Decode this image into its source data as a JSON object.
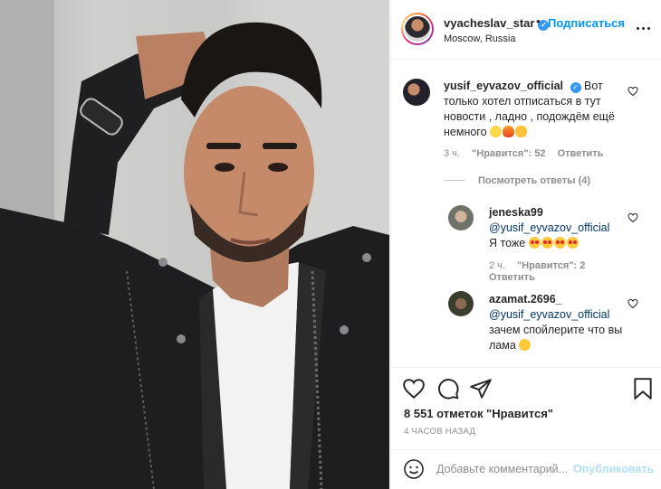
{
  "post": {
    "owner": "vyacheslav_star",
    "dot": "•",
    "follow_label": "Подписаться",
    "location": "Moscow, Russia"
  },
  "comments": [
    {
      "username": "yusif_eyvazov_official",
      "text": "Вот только хотел отписаться в тут новости , ладно , подождём ещё немного",
      "time": "3 ч.",
      "likes": "\"Нравится\": 52",
      "reply": "Ответить",
      "view_replies": "Посмотреть ответы (4)"
    },
    {
      "username": "jeneska99",
      "mention": "@yusif_eyvazov_official",
      "text": "Я тоже",
      "time": "2 ч.",
      "likes": "\"Нравится\": 2",
      "reply": "Ответить"
    },
    {
      "username": "azamat.2696_",
      "mention": "@yusif_eyvazov_official",
      "text": "зачем спойлерите что вы лама"
    }
  ],
  "actions": {
    "likes_count": "8 551 отметок \"Нравится\"",
    "timestamp": "4 ЧАСОВ НАЗАД"
  },
  "comment_box": {
    "placeholder": "Добавьте комментарий...",
    "publish_label": "Опубликовать"
  },
  "colors": {
    "accent": "#0095f6",
    "verified": "#3897f0",
    "publish_disabled": "#b2dffc",
    "muted": "#8e8e8e"
  },
  "icons": [
    "verified-badge-icon",
    "more-options-icon",
    "heart-icon",
    "comment-icon",
    "share-icon",
    "bookmark-icon",
    "emoji-icon"
  ]
}
